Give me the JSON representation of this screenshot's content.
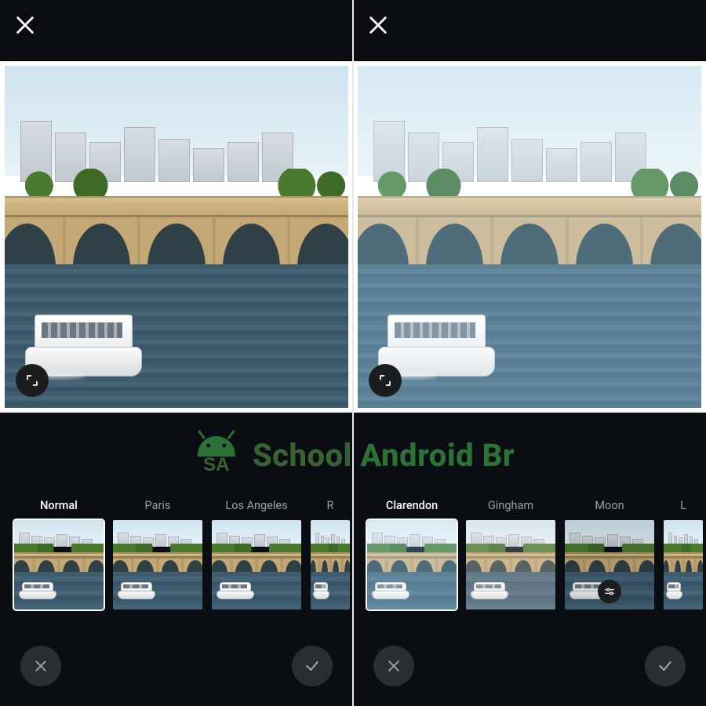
{
  "watermark": {
    "text_a": "School ",
    "text_b": "Android Br",
    "badge_letters": "SA"
  },
  "left": {
    "selected_index": 0,
    "filters": [
      {
        "label": "Normal",
        "tint": ""
      },
      {
        "label": "Paris",
        "tint": "tint-paris"
      },
      {
        "label": "Los Angeles",
        "tint": "tint-la"
      },
      {
        "label": "R",
        "tint": "tint-la",
        "partial": true
      }
    ],
    "preview_tint": ""
  },
  "right": {
    "selected_index": 0,
    "filters": [
      {
        "label": "Clarendon",
        "tint": "tint-clarendon"
      },
      {
        "label": "Gingham",
        "tint": "tint-gingham"
      },
      {
        "label": "Moon",
        "tint": "tint-moon",
        "show_adjust_badge": true
      },
      {
        "label": "L",
        "tint": "tint-lark",
        "partial": true
      }
    ],
    "preview_tint": "tint-clarendon"
  }
}
